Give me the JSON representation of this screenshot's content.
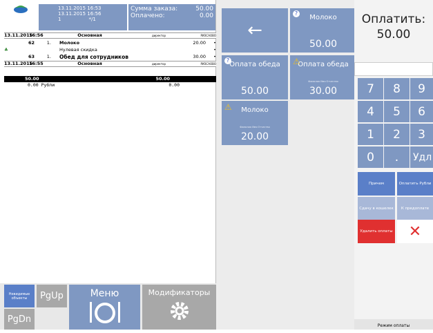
{
  "header": {
    "datetime1": "13.11.2015 16:53",
    "datetime2": "13.11.2015 16:56",
    "num": "1",
    "slash": "*/1",
    "sum_label": "Сумма заказа:",
    "sum_value": "50.00",
    "paid_label": "Оплачено:",
    "paid_value": "0.00"
  },
  "order": {
    "groups": [
      {
        "date": "13.11.2015",
        "time": "16:56",
        "type": "Основная",
        "who": "директор",
        "code": "РИЗСАОВО"
      },
      {
        "date": "13.11.2015",
        "time": "16:55",
        "type": "Основная",
        "who": "директор",
        "code": "РИЗСАОВО"
      }
    ],
    "items": [
      {
        "seat": "62",
        "qty": "1.",
        "name": "Молоко",
        "price": "20.00",
        "mark": "•"
      },
      {
        "seat": "",
        "qty": "",
        "name": "Нулевая скидка",
        "price": "",
        "mark": "•"
      },
      {
        "seat": "63",
        "qty": "1.",
        "name": "Обед для сотрудников",
        "price": "30.00",
        "mark": "•"
      }
    ],
    "total": {
      "left": "50.00",
      "right": "50.00"
    },
    "rub": {
      "left": "0.00 Рубли",
      "right": "0.00"
    }
  },
  "leftbtns": {
    "unrelated": "Невидимые объекты",
    "pgup": "PgUp",
    "pgdn": "PgDn",
    "menu": "Меню",
    "mods": "Модификаторы"
  },
  "tiles": {
    "back": "←",
    "milk1": {
      "title": "Молоко",
      "price": "50.00"
    },
    "pay1": {
      "title": "Оплата обеда",
      "price": "50.00"
    },
    "pay2": {
      "title": "Оплата обеда",
      "sub": "Фамилия Имя Отчество",
      "price": "30.00"
    },
    "milk2": {
      "title": "Молоко",
      "sub": "Фамилия Имя Отчество",
      "price": "20.00"
    }
  },
  "pay": {
    "label": "Оплатить:",
    "amount": "50.00"
  },
  "keys": [
    "7",
    "8",
    "9",
    "4",
    "5",
    "6",
    "1",
    "2",
    "3",
    "0",
    ".",
    "Удл"
  ],
  "fbtns": {
    "reasons": "Причем",
    "pay_rub": "Оплатить Рубли",
    "change": "Сдачу в кошелек",
    "continue": "К предоплате",
    "delete": "Удалить оплаты",
    "cancel": "✕"
  },
  "mode": "Режим оплаты",
  "colors": {
    "tile": "#7f98c2",
    "red": "#e03030",
    "keyblue": "#5a7fc8"
  }
}
